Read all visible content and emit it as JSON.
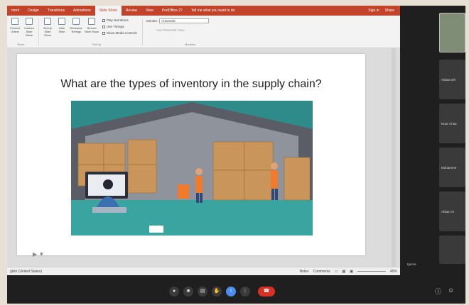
{
  "ppt": {
    "tabs": [
      "ment",
      "Design",
      "Transitions",
      "Animations",
      "Slide Show",
      "Review",
      "View",
      "PodOffice 2?",
      "Tell me what you want to do"
    ],
    "active_tab": "Slide Show",
    "account": [
      "Sign in",
      "Share"
    ],
    "ribbon": {
      "buttons": [
        "Present Online",
        "Custom Slide Show",
        "Set Up Slide Show",
        "Hide Slide",
        "Rehearse Timings",
        "Record Slide Show"
      ],
      "checks": [
        "Play Narrations",
        "Use Timings",
        "Show Media Controls"
      ],
      "monitor_label": "Monitor:",
      "monitor_value": "Automatic",
      "presenter_view": "Use Presenter View",
      "groups": [
        "Show",
        "Set Up",
        "Monitors"
      ]
    },
    "slide": {
      "title": "What are the types of inventory in the supply chain?"
    },
    "status": {
      "left": "glish (United States)",
      "notes": "Notes",
      "comments": "Comments",
      "zoom": "49%"
    }
  },
  "participants": [
    {
      "name": "Adnan Dh"
    },
    {
      "name": "Noor Al Bu"
    },
    {
      "name": "Mohamme"
    },
    {
      "name": "Ahlam Al"
    }
  ],
  "speaker_label": "Ignore",
  "colors": {
    "ribbon_accent": "#c0432a",
    "share_button": "#4a8df0",
    "hangup_button": "#d93025"
  },
  "icons": [
    "mic-icon",
    "camera-icon",
    "captions-icon",
    "raise-hand-icon",
    "present-icon",
    "more-icon",
    "end-call-icon",
    "info-icon",
    "people-icon"
  ]
}
